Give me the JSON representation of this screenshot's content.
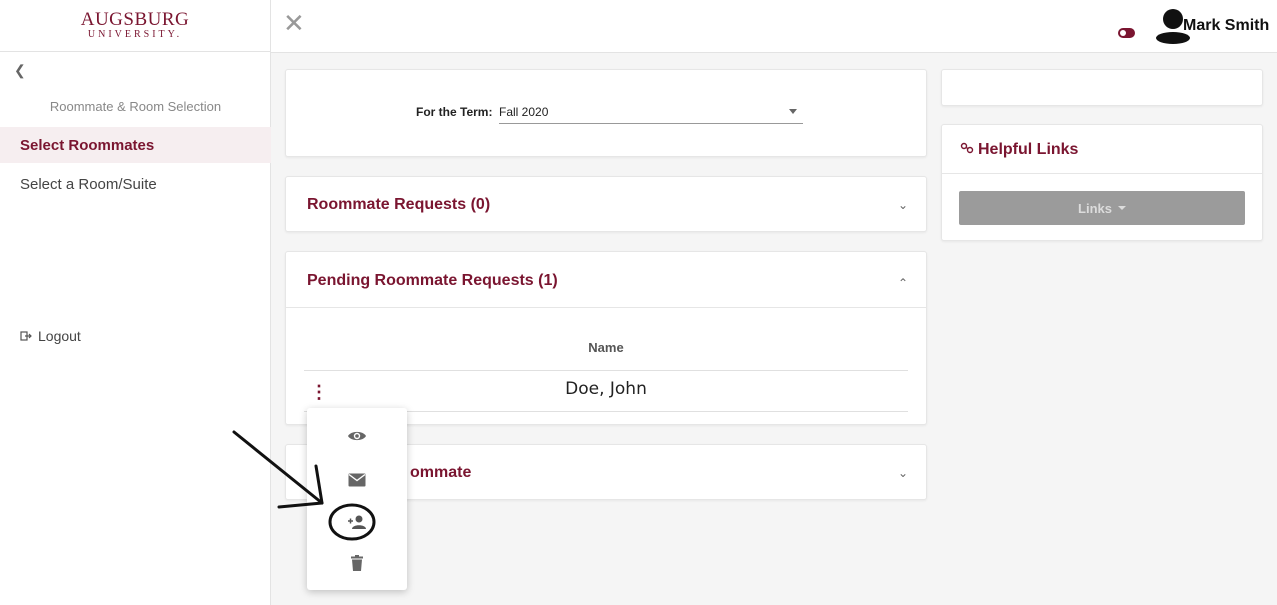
{
  "brand": {
    "logo_main": "AUGSBURG",
    "logo_sub": "UNIVERSITY."
  },
  "sidebar": {
    "section_heading": "Roommate & Room Selection",
    "items": [
      {
        "label": "Select Roommates",
        "active": true
      },
      {
        "label": "Select a Room/Suite",
        "active": false
      }
    ],
    "logout_label": "Logout"
  },
  "topbar": {
    "user_name": "Mark Smith"
  },
  "term": {
    "label": "For the Term:",
    "selected": "Fall 2020"
  },
  "roommate_requests": {
    "title": "Roommate Requests (0)"
  },
  "pending_requests": {
    "title": "Pending Roommate Requests (1)",
    "column_header": "Name",
    "rows": [
      {
        "name": "Doe, John"
      }
    ]
  },
  "add_roommate": {
    "title_visible": "ommate"
  },
  "helpful_links": {
    "title": "Helpful Links",
    "button_label": "Links"
  },
  "row_menu": {
    "items": [
      "view-icon",
      "email-icon",
      "add-person-icon",
      "delete-icon"
    ]
  },
  "colors": {
    "brand": "#7a1530",
    "disabled_button": "#9b9b9b"
  }
}
